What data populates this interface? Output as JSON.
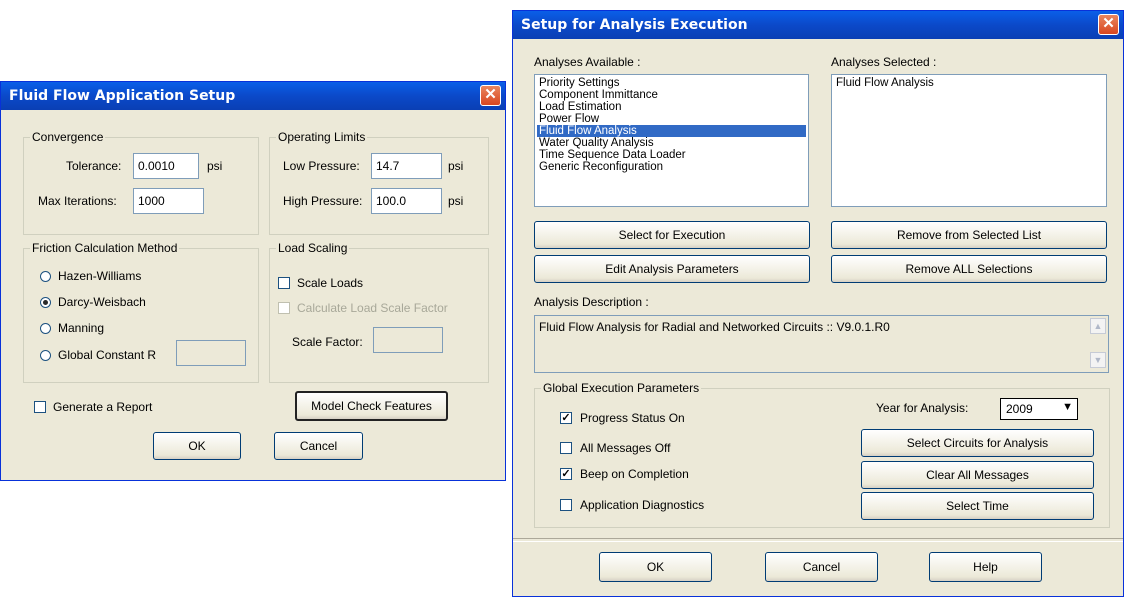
{
  "left_dialog": {
    "title": "Fluid Flow Application Setup",
    "convergence": {
      "label": "Convergence",
      "tolerance_label": "Tolerance:",
      "tolerance_value": "0.0010",
      "tolerance_unit": "psi",
      "max_iter_label": "Max Iterations:",
      "max_iter_value": "1000"
    },
    "operating_limits": {
      "label": "Operating Limits",
      "low_label": "Low Pressure:",
      "low_value": "14.7",
      "low_unit": "psi",
      "high_label": "High Pressure:",
      "high_value": "100.0",
      "high_unit": "psi"
    },
    "friction": {
      "label": "Friction Calculation Method",
      "options": [
        "Hazen-Williams",
        "Darcy-Weisbach",
        "Manning",
        "Global Constant R"
      ],
      "selected": "Darcy-Weisbach",
      "global_r_value": ""
    },
    "load_scaling": {
      "label": "Load Scaling",
      "scale_loads": "Scale Loads",
      "calc_factor": "Calculate Load Scale Factor",
      "factor_label": "Scale Factor:",
      "factor_value": ""
    },
    "generate_report": "Generate a Report",
    "model_check": "Model Check Features",
    "ok": "OK",
    "cancel": "Cancel"
  },
  "right_dialog": {
    "title": "Setup for Analysis Execution",
    "available_label": "Analyses Available :",
    "selected_label": "Analyses Selected :",
    "available": [
      "Priority Settings",
      "Component Immittance",
      "Load Estimation",
      "Power Flow",
      "Fluid Flow Analysis",
      "Water Quality Analysis",
      "Time Sequence Data Loader",
      "Generic Reconfiguration"
    ],
    "available_selected": "Fluid Flow Analysis",
    "selected": [
      "Fluid Flow Analysis"
    ],
    "select_exec": "Select for Execution",
    "remove_selected": "Remove from Selected List",
    "edit_params": "Edit Analysis Parameters",
    "remove_all": "Remove ALL Selections",
    "desc_label": "Analysis Description :",
    "desc_text": "Fluid Flow Analysis for Radial and Networked Circuits :: V9.0.1.R0",
    "global": {
      "label": "Global Execution Parameters",
      "progress": "Progress Status On",
      "messages_off": "All Messages Off",
      "beep": "Beep on Completion",
      "diagnostics": "Application Diagnostics",
      "year_label": "Year for Analysis:",
      "year_value": "2009",
      "select_circuits": "Select Circuits for Analysis",
      "clear_messages": "Clear All Messages",
      "select_time": "Select Time"
    },
    "ok": "OK",
    "cancel": "Cancel",
    "help": "Help"
  }
}
